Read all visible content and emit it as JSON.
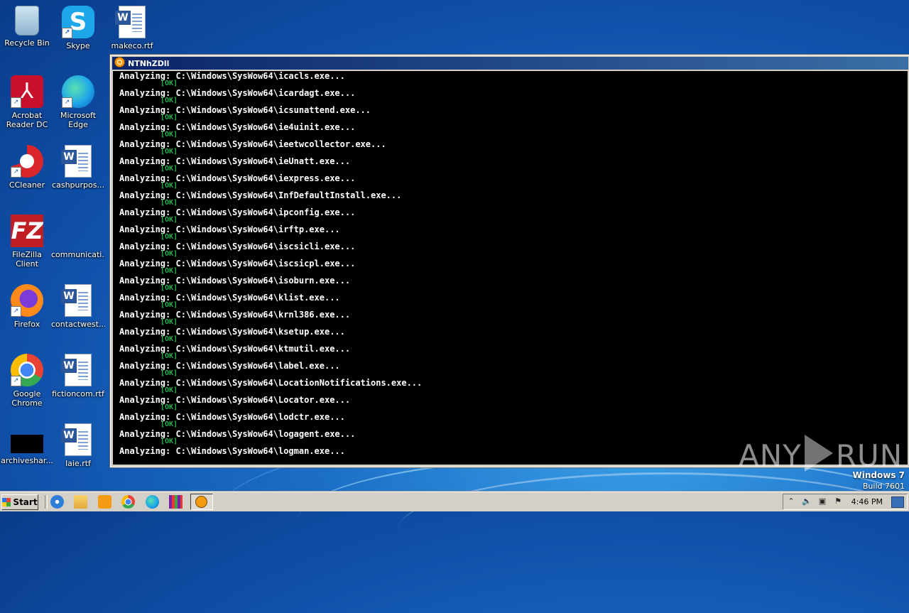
{
  "desktop": {
    "icons": [
      {
        "label": "Recycle Bin",
        "icon": "recycle-bin-icon"
      },
      {
        "label": "Skype",
        "icon": "skype-icon"
      },
      {
        "label": "makeco.rtf",
        "icon": "word-document-icon"
      },
      {
        "label": "Acrobat Reader DC",
        "icon": "acrobat-icon"
      },
      {
        "label": "Microsoft Edge",
        "icon": "edge-icon"
      },
      {
        "label": "CCleaner",
        "icon": "ccleaner-icon"
      },
      {
        "label": "cashpurpos...",
        "icon": "word-document-icon"
      },
      {
        "label": "FileZilla Client",
        "icon": "filezilla-icon"
      },
      {
        "label": "communicati...",
        "icon": "blank-file-icon"
      },
      {
        "label": "Firefox",
        "icon": "firefox-icon"
      },
      {
        "label": "contactwest...",
        "icon": "word-document-icon"
      },
      {
        "label": "Google Chrome",
        "icon": "chrome-icon"
      },
      {
        "label": "fictioncom.rtf",
        "icon": "word-document-icon"
      },
      {
        "label": "archiveshar...",
        "icon": "black-file-icon"
      },
      {
        "label": "laie.rtf",
        "icon": "word-document-icon"
      }
    ]
  },
  "window": {
    "title": "NTNhZDll",
    "ok_text": "[OK]",
    "lines": [
      "Analyzing: C:\\Windows\\SysWow64\\icacls.exe...",
      "Analyzing: C:\\Windows\\SysWow64\\icardagt.exe...",
      "Analyzing: C:\\Windows\\SysWow64\\icsunattend.exe...",
      "Analyzing: C:\\Windows\\SysWow64\\ie4uinit.exe...",
      "Analyzing: C:\\Windows\\SysWow64\\ieetwcollector.exe...",
      "Analyzing: C:\\Windows\\SysWow64\\ieUnatt.exe...",
      "Analyzing: C:\\Windows\\SysWow64\\iexpress.exe...",
      "Analyzing: C:\\Windows\\SysWow64\\InfDefaultInstall.exe...",
      "Analyzing: C:\\Windows\\SysWow64\\ipconfig.exe...",
      "Analyzing: C:\\Windows\\SysWow64\\irftp.exe...",
      "Analyzing: C:\\Windows\\SysWow64\\iscsicli.exe...",
      "Analyzing: C:\\Windows\\SysWow64\\iscsicpl.exe...",
      "Analyzing: C:\\Windows\\SysWow64\\isoburn.exe...",
      "Analyzing: C:\\Windows\\SysWow64\\klist.exe...",
      "Analyzing: C:\\Windows\\SysWow64\\krnl386.exe...",
      "Analyzing: C:\\Windows\\SysWow64\\ksetup.exe...",
      "Analyzing: C:\\Windows\\SysWow64\\ktmutil.exe...",
      "Analyzing: C:\\Windows\\SysWow64\\label.exe...",
      "Analyzing: C:\\Windows\\SysWow64\\LocationNotifications.exe...",
      "Analyzing: C:\\Windows\\SysWow64\\Locator.exe...",
      "Analyzing: C:\\Windows\\SysWow64\\lodctr.exe...",
      "Analyzing: C:\\Windows\\SysWow64\\logagent.exe...",
      "Analyzing: C:\\Windows\\SysWow64\\logman.exe..."
    ]
  },
  "watermark": {
    "left": "ANY",
    "right": "RUN"
  },
  "os": {
    "name": "Windows 7",
    "build": "Build 7601"
  },
  "taskbar": {
    "start_label": "Start",
    "quick_launch": [
      "ie-icon",
      "folder-icon",
      "media-player-icon",
      "chrome-icon",
      "edge-icon",
      "winrar-icon"
    ],
    "clock": "4:46 PM"
  }
}
